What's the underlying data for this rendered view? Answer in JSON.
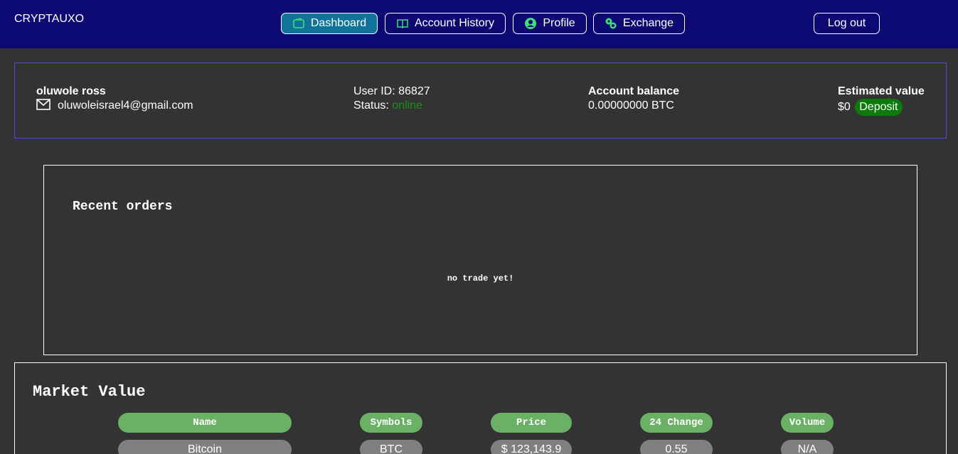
{
  "brand": "CRYPTAUXO",
  "nav": {
    "dashboard": "Dashboard",
    "account_history": "Account History",
    "profile": "Profile",
    "exchange": "Exchange",
    "logout": "Log out"
  },
  "user": {
    "name": "oluwole ross",
    "email": "oluwoleisrael4@gmail.com",
    "user_id_label": "User ID: 86827",
    "status_label": "Status:",
    "status_value": "online"
  },
  "balance": {
    "label": "Account balance",
    "value": "0.00000000 BTC"
  },
  "estimate": {
    "label": "Estimated value",
    "value": "$0",
    "deposit": "Deposit"
  },
  "orders": {
    "title": "Recent orders",
    "empty": "no trade yet!"
  },
  "market": {
    "title": "Market Value",
    "headers": [
      "Name",
      "Symbols",
      "Price",
      "24 Change",
      "Volume"
    ],
    "rows": [
      [
        "Bitcoin",
        "BTC",
        "$ 123,143.9",
        "0.55",
        "N/A"
      ]
    ]
  },
  "colors": {
    "topbar": "#0c0a72",
    "active_nav": "#10749a",
    "online": "#1e8f1e",
    "deposit": "#0b7a0b",
    "header_pill": "#6ab165",
    "cell_pill": "#808080"
  }
}
